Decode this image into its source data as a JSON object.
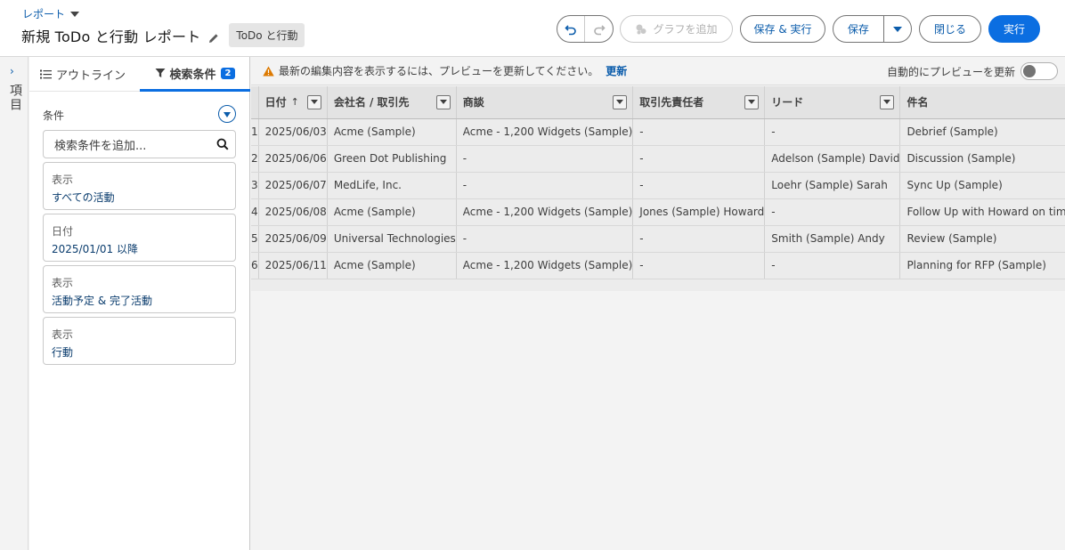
{
  "header": {
    "breadcrumb": "レポート",
    "title": "新規 ToDo と行動 レポート",
    "report_type": "ToDo と行動",
    "add_chart_label": "グラフを追加",
    "save_run_label": "保存 & 実行",
    "save_label": "保存",
    "close_label": "閉じる",
    "run_label": "実行"
  },
  "rail": {
    "label": "項目"
  },
  "panel": {
    "tabs": {
      "outline": "アウトライン",
      "filters": "検索条件",
      "filters_count": "2"
    },
    "conditions_label": "条件",
    "search_placeholder": "検索条件を追加...",
    "filters": [
      {
        "key": "表示",
        "value": "すべての活動"
      },
      {
        "key": "日付",
        "value": "2025/01/01 以降"
      },
      {
        "key": "表示",
        "value": "活動予定 & 完了活動"
      },
      {
        "key": "表示",
        "value": "行動"
      }
    ]
  },
  "notice": {
    "message": "最新の編集内容を表示するには、プレビューを更新してください。",
    "update_link": "更新",
    "auto_preview_label": "自動的にプレビューを更新"
  },
  "table": {
    "columns": [
      "日付",
      "会社名 / 取引先",
      "商談",
      "取引先責任者",
      "リード",
      "件名"
    ],
    "sort_indicator": "↑",
    "rows": [
      [
        "1",
        "2025/06/03",
        "Acme (Sample)",
        "Acme - 1,200 Widgets (Sample)",
        "-",
        "-",
        "Debrief (Sample)"
      ],
      [
        "2",
        "2025/06/06",
        "Green Dot Publishing",
        "-",
        "-",
        "Adelson (Sample) David",
        "Discussion (Sample)"
      ],
      [
        "3",
        "2025/06/07",
        "MedLife, Inc.",
        "-",
        "-",
        "Loehr (Sample) Sarah",
        "Sync Up (Sample)"
      ],
      [
        "4",
        "2025/06/08",
        "Acme (Sample)",
        "Acme - 1,200 Widgets (Sample)",
        "Jones (Sample) Howard",
        "-",
        "Follow Up with Howard on timing (S"
      ],
      [
        "5",
        "2025/06/09",
        "Universal Technologies",
        "-",
        "-",
        "Smith (Sample) Andy",
        "Review (Sample)"
      ],
      [
        "6",
        "2025/06/11",
        "Acme (Sample)",
        "Acme - 1,200 Widgets (Sample)",
        "-",
        "-",
        "Planning for RFP (Sample)"
      ]
    ]
  }
}
